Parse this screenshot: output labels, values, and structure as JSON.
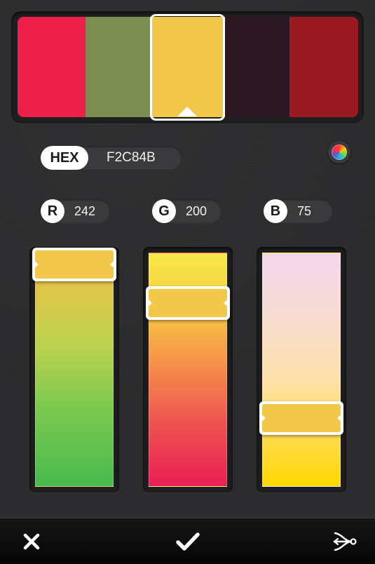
{
  "palette": {
    "swatches": [
      {
        "color": "#ef1f4c",
        "selected": false
      },
      {
        "color": "#7b8d50",
        "selected": false
      },
      {
        "color": "#f2c84b",
        "selected": true
      },
      {
        "color": "#2b1622",
        "selected": false
      },
      {
        "color": "#9b1920",
        "selected": false
      }
    ]
  },
  "hex": {
    "label": "HEX",
    "value": "F2C84B"
  },
  "channels": {
    "r": {
      "label": "R",
      "value": "242",
      "level": 0.949
    },
    "g": {
      "label": "G",
      "value": "200",
      "level": 0.784
    },
    "b": {
      "label": "B",
      "value": "75",
      "level": 0.294
    }
  },
  "icons": {
    "color_wheel": "color-wheel-icon",
    "cancel": "close-icon",
    "confirm": "checkmark-icon",
    "share": "share-icon"
  }
}
